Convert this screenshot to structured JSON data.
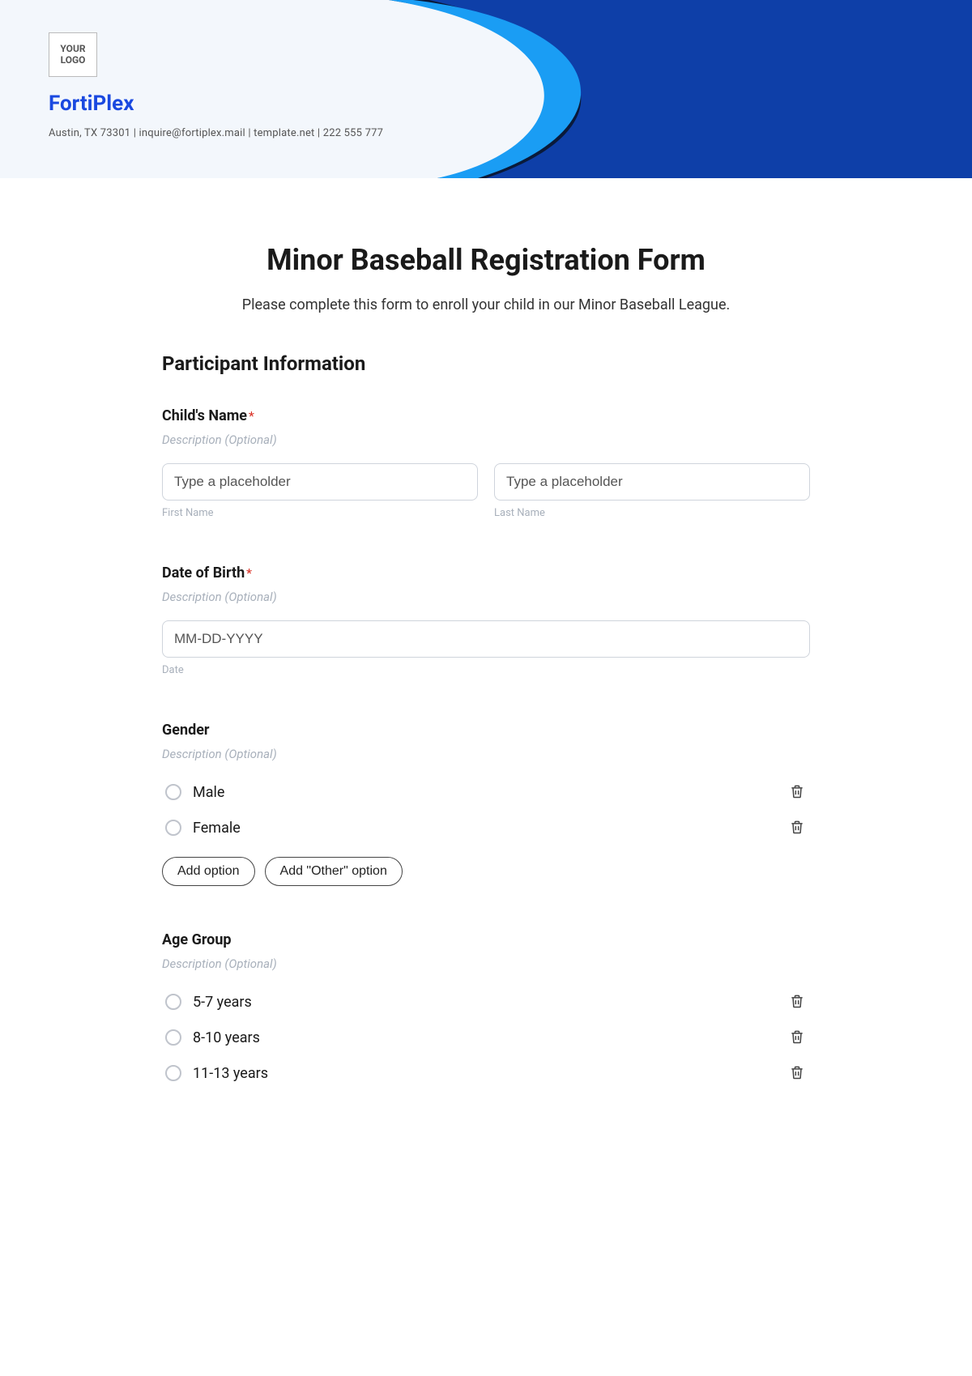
{
  "header": {
    "logo_text": "YOUR LOGO",
    "brand": "FortiPlex",
    "contact": "Austin, TX 73301 | inquire@fortiplex.mail | template.net | 222 555 777"
  },
  "form": {
    "title": "Minor Baseball Registration Form",
    "subtitle": "Please complete this form to enroll your child in our Minor Baseball League.",
    "section1_title": "Participant Information",
    "child_name": {
      "label": "Child's Name",
      "required": "*",
      "desc": "Description (Optional)",
      "first_placeholder": "Type a placeholder",
      "first_sub": "First Name",
      "last_placeholder": "Type a placeholder",
      "last_sub": "Last Name"
    },
    "dob": {
      "label": "Date of Birth",
      "required": "*",
      "desc": "Description (Optional)",
      "placeholder": "MM-DD-YYYY",
      "sub": "Date"
    },
    "gender": {
      "label": "Gender",
      "desc": "Description (Optional)",
      "options": [
        "Male",
        "Female"
      ],
      "add_option": "Add option",
      "add_other": "Add \"Other\" option"
    },
    "age_group": {
      "label": "Age Group",
      "desc": "Description (Optional)",
      "options": [
        "5-7 years",
        "8-10 years",
        "11-13 years"
      ]
    }
  }
}
